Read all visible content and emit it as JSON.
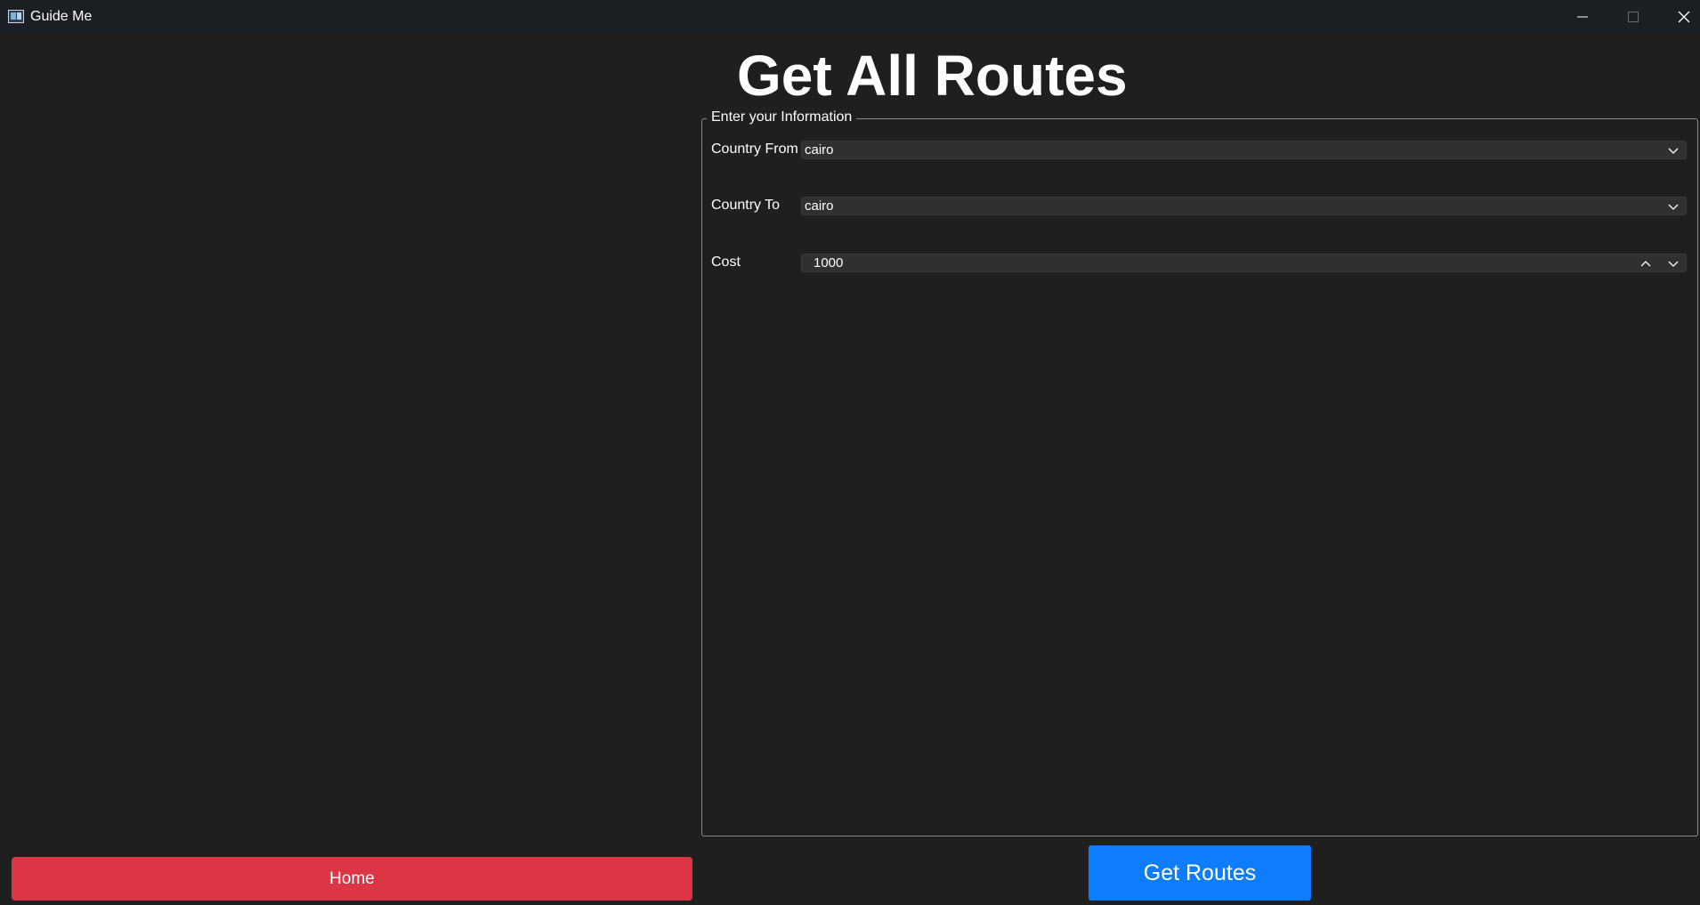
{
  "window": {
    "title": "Guide Me",
    "icon": "app-window-icon",
    "controls": [
      "minimize-icon",
      "maximize-icon",
      "close-icon"
    ]
  },
  "page": {
    "heading": "Get All Routes"
  },
  "form": {
    "group_title": "Enter your Information",
    "country_from": {
      "label": "Country From",
      "value": "cairo"
    },
    "country_to": {
      "label": "Country To",
      "value": "cairo"
    },
    "cost": {
      "label": "Cost",
      "value": "1000"
    }
  },
  "buttons": {
    "home_label": "Home",
    "get_routes_label": "Get Routes"
  },
  "colors": {
    "background": "#1f1f1f",
    "titlebar": "#1b1e22",
    "home_button": "#dc3545",
    "get_routes_button": "#0d7dfd",
    "input_background": "#303030"
  }
}
